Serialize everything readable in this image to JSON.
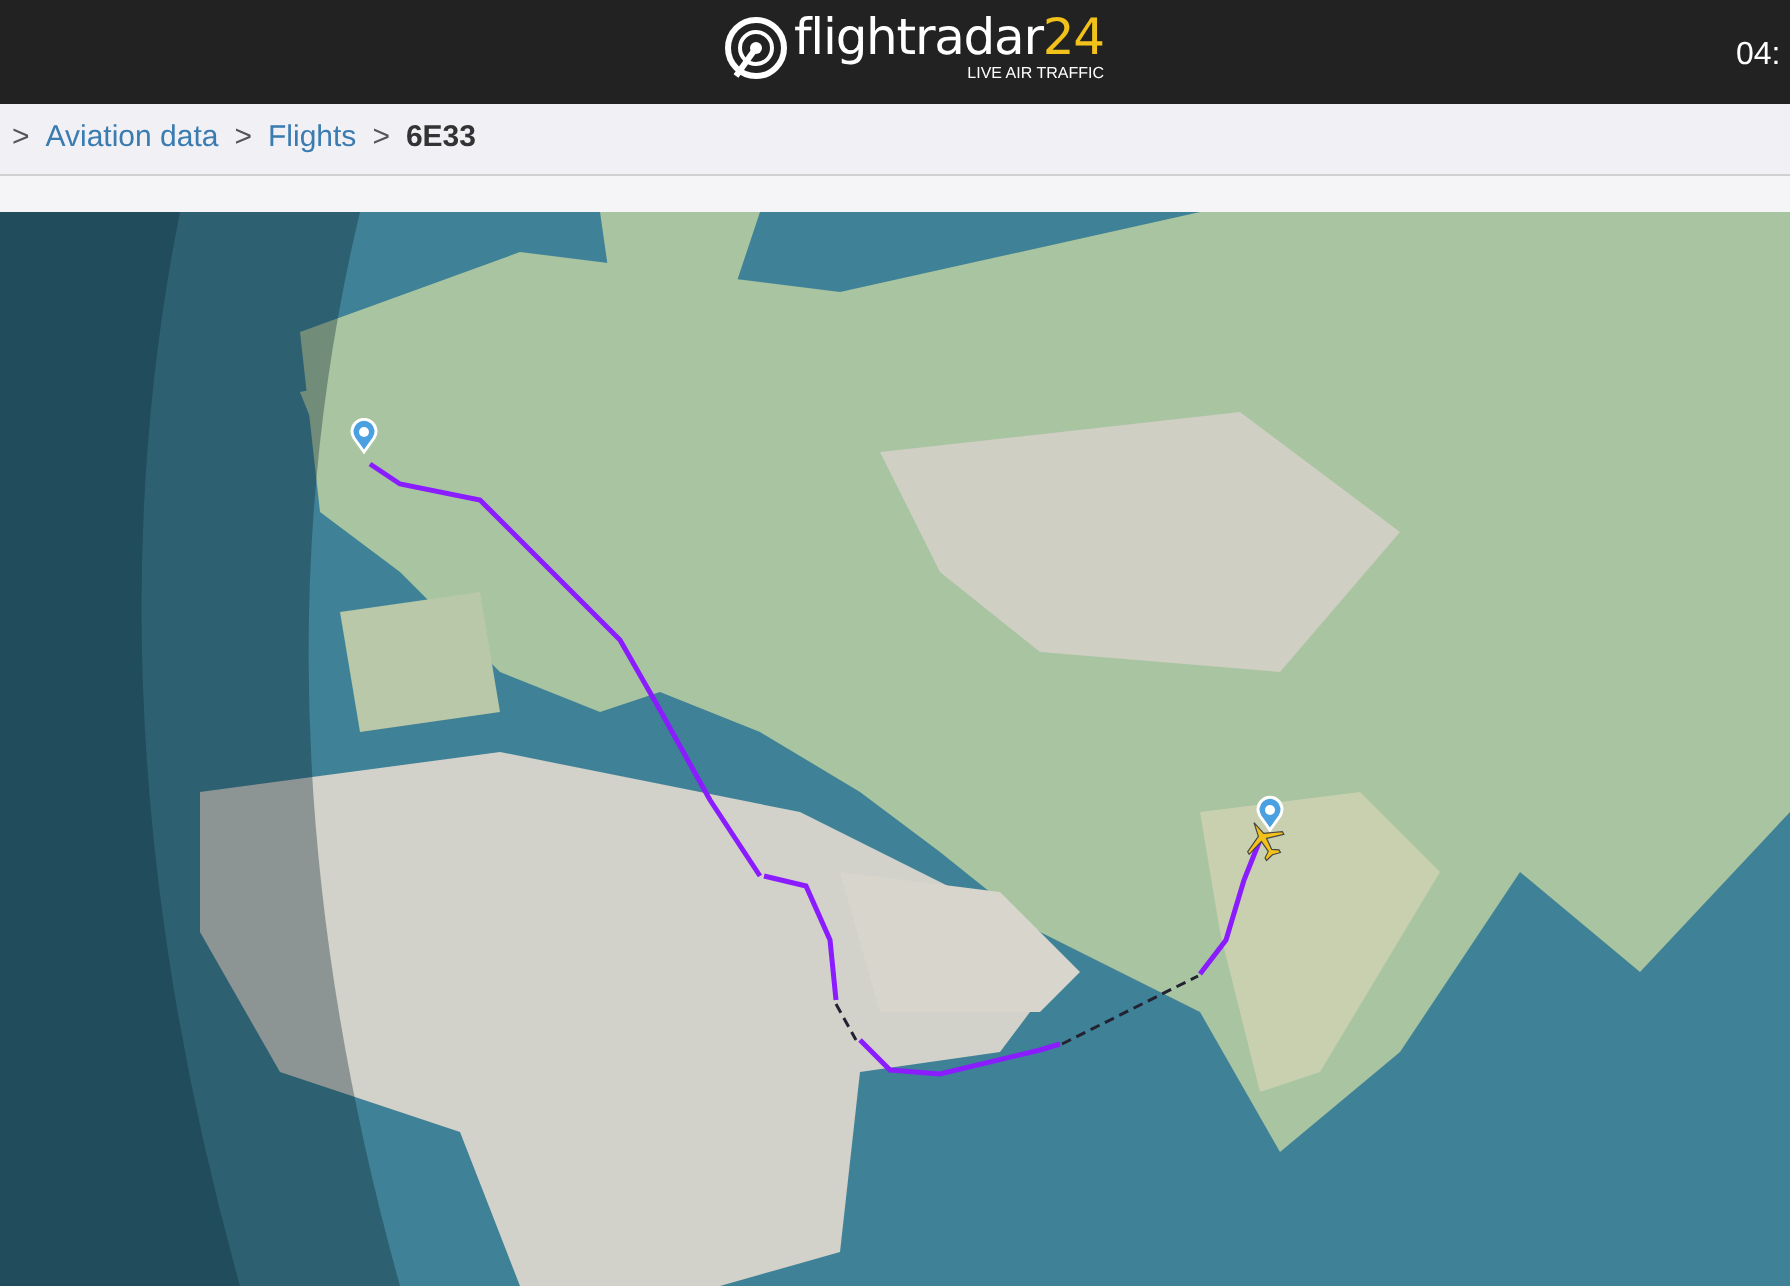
{
  "header": {
    "logo_name": "flightradar",
    "logo_number": "24",
    "tagline": "LIVE AIR TRAFFIC",
    "clock": "04:"
  },
  "breadcrumb": {
    "separator": ">",
    "items": [
      {
        "label": "Aviation data",
        "link": true
      },
      {
        "label": "Flights",
        "link": true
      },
      {
        "label": "6E33",
        "link": false
      }
    ]
  }
}
